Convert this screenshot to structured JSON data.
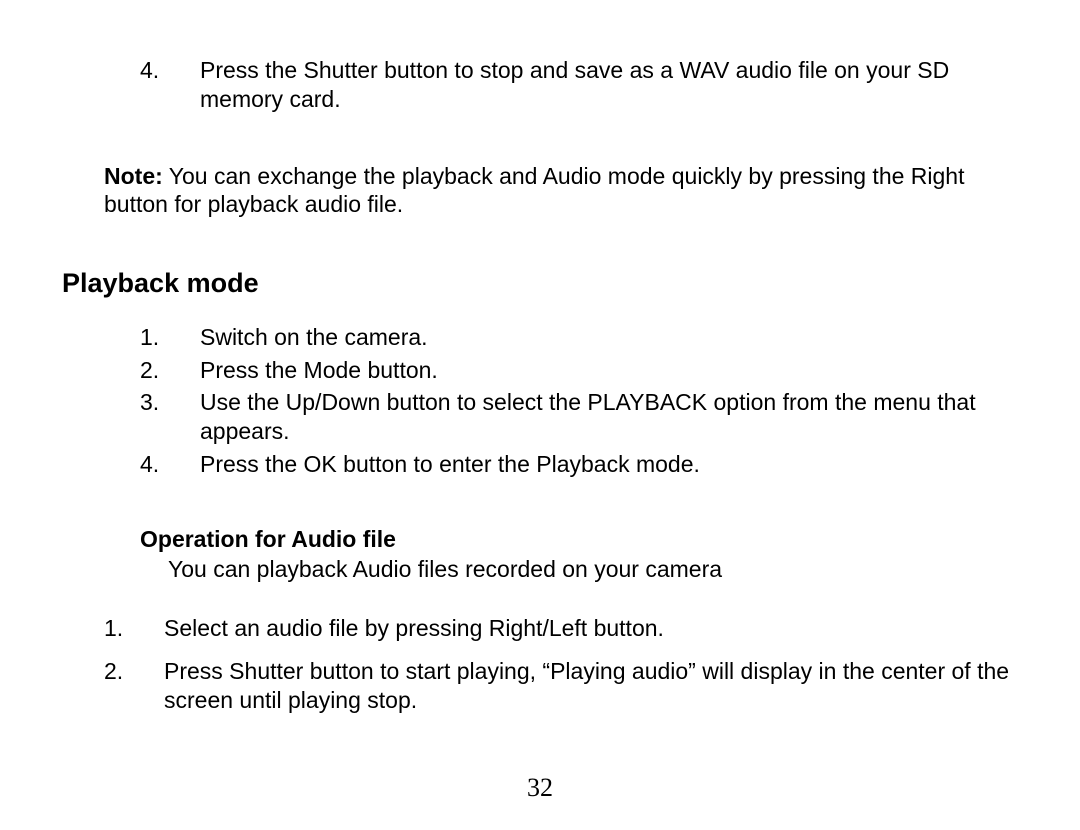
{
  "top_list": {
    "start": 4,
    "items": [
      {
        "num": "4.",
        "text": "Press the Shutter button to stop and save as a WAV audio file on your SD memory card."
      }
    ]
  },
  "note": {
    "label": "Note:",
    "text": " You can exchange the playback and Audio mode quickly by pressing the Right button for playback audio file."
  },
  "heading_playback": "Playback mode",
  "playback_list": {
    "items": [
      {
        "num": "1.",
        "text": "Switch on the camera."
      },
      {
        "num": "2.",
        "text": "Press the Mode button."
      },
      {
        "num": "3.",
        "text": "Use the Up/Down button to select the PLAYBACK option from the menu that appears."
      },
      {
        "num": "4.",
        "text": "Press the OK button to enter the Playback mode."
      }
    ]
  },
  "heading_audio": "Operation for Audio file",
  "audio_intro": "You can playback Audio files recorded on your camera",
  "audio_list": {
    "items": [
      {
        "num": "1.",
        "text": "Select an audio file by pressing Right/Left button."
      },
      {
        "num": "2.",
        "text": "Press Shutter button to start playing, “Playing audio” will display in the center of the screen until playing stop."
      }
    ]
  },
  "page_number": "32"
}
